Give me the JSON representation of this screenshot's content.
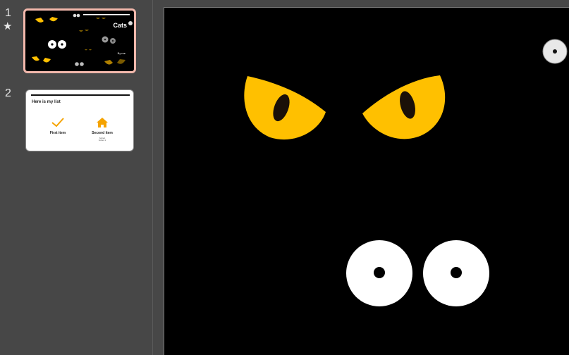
{
  "sidebar": {
    "slides": [
      {
        "number": "1",
        "starred": true,
        "thumbnail": {
          "title": "Cats",
          "byline": "By me"
        }
      },
      {
        "number": "2",
        "starred": false,
        "thumbnail": {
          "title": "Here is my list",
          "items": [
            {
              "label": "First item",
              "icon": "checkmark-icon"
            },
            {
              "label": "Second item",
              "icon": "home-icon",
              "sub": [
                "Subtext",
                "Subtext 2"
              ]
            }
          ]
        }
      }
    ]
  },
  "colors": {
    "sidebar_bg": "#474747",
    "selected_border": "#f2b8ac",
    "slide_bg": "#000000",
    "cat_eye": "#ffc000",
    "accent_orange": "#f5a300"
  }
}
